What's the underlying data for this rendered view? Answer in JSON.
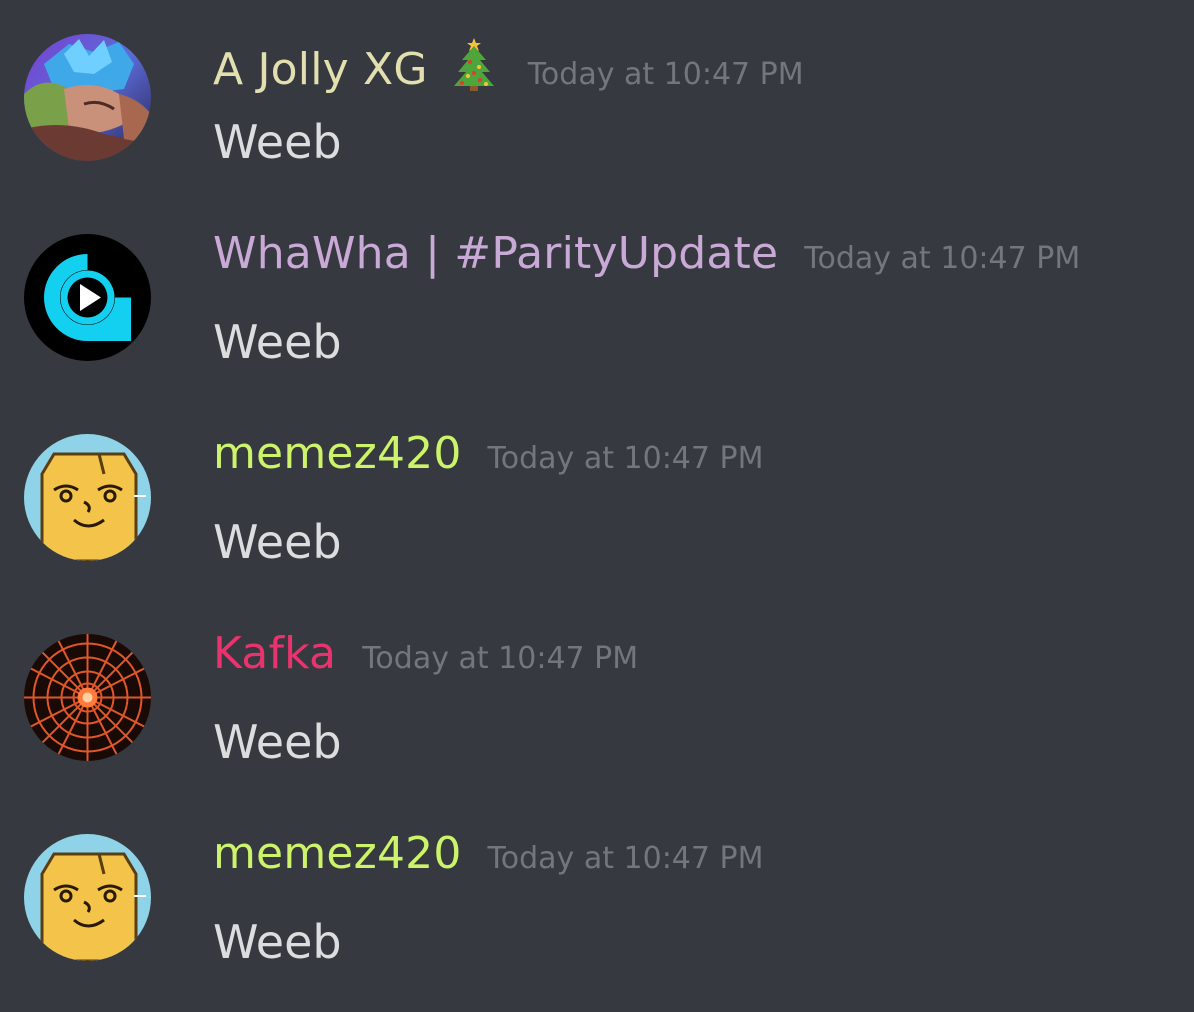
{
  "messages": [
    {
      "author": "A Jolly XG",
      "author_color": "#e3e0b0",
      "has_tree_emoji": true,
      "timestamp": "Today at 10:47 PM",
      "text": "Weeb",
      "avatar": "anime-avatar-icon"
    },
    {
      "author": "WhaWha | #ParityUpdate",
      "author_color": "#c9a9d6",
      "timestamp": "Today at 10:47 PM",
      "text": "Weeb",
      "avatar": "play-logo-avatar-icon"
    },
    {
      "author": "memez420",
      "author_color": "#ccf36a",
      "timestamp": "Today at 10:47 PM",
      "text": "Weeb",
      "avatar": "lenny-face-avatar-icon"
    },
    {
      "author": "Kafka",
      "author_color": "#e9336e",
      "timestamp": "Today at 10:47 PM",
      "text": "Weeb",
      "avatar": "orange-web-avatar-icon"
    },
    {
      "author": "memez420",
      "author_color": "#ccf36a",
      "timestamp": "Today at 10:47 PM",
      "text": "Weeb",
      "avatar": "lenny-face-avatar-icon"
    }
  ]
}
